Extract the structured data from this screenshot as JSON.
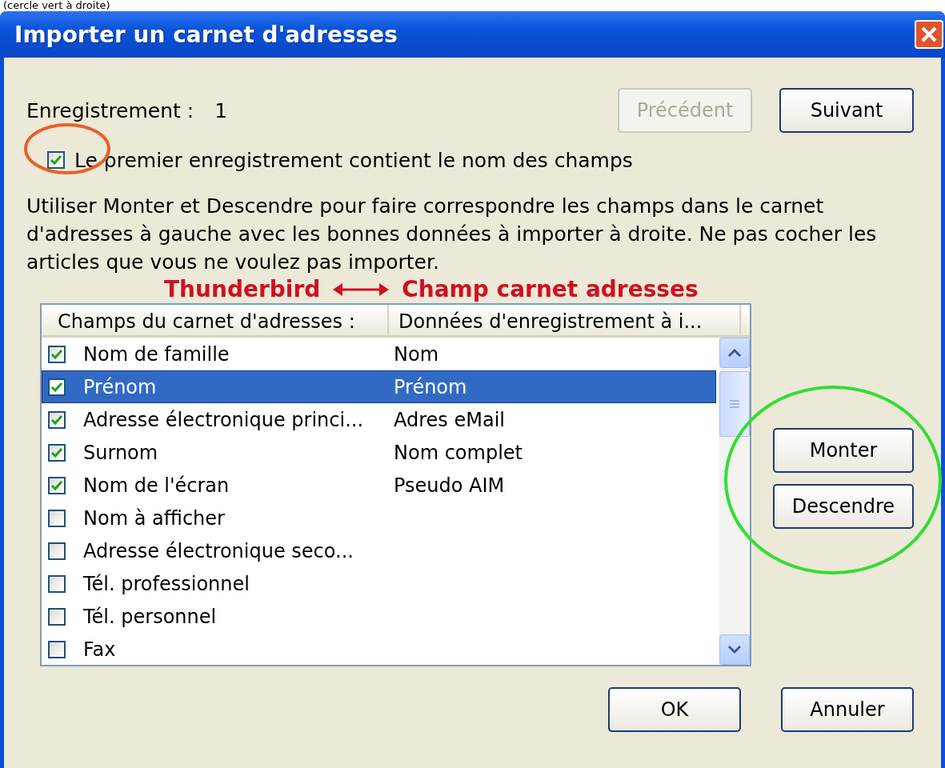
{
  "caption": "(cercle vert à droite)",
  "window": {
    "title": "Importer un carnet d'adresses"
  },
  "record": {
    "label": "Enregistrement :",
    "value": "1"
  },
  "nav_buttons": [
    {
      "label": "Précédent",
      "disabled": true
    },
    {
      "label": "Suivant",
      "disabled": false
    }
  ],
  "first_record_checkbox": {
    "label": "Le premier enregistrement contient le nom des champs",
    "checked": true
  },
  "instructions": "Utiliser Monter et Descendre pour faire correspondre les champs dans le carnet d'adresses à gauche avec les bonnes données à importer à droite. Ne pas cocher les articles que vous ne voulez pas importer.",
  "annotation": {
    "left": "Thunderbird",
    "right": "Champ carnet adresses"
  },
  "table": {
    "columns": [
      "Champs du carnet d'adresses :",
      "Données d'enregistrement à i..."
    ],
    "rows": [
      {
        "field": "Nom de famille",
        "data": "Nom",
        "checked": true,
        "selected": false
      },
      {
        "field": "Prénom",
        "data": "Prénom",
        "checked": true,
        "selected": true
      },
      {
        "field": "Adresse électronique princi...",
        "data": "Adres eMail",
        "checked": true,
        "selected": false
      },
      {
        "field": "Surnom",
        "data": "Nom complet",
        "checked": true,
        "selected": false
      },
      {
        "field": "Nom de l'écran",
        "data": "Pseudo AIM",
        "checked": true,
        "selected": false
      },
      {
        "field": "Nom à afficher",
        "checked": false,
        "selected": false
      },
      {
        "field": "Adresse électronique seco...",
        "checked": false,
        "selected": false
      },
      {
        "field": "Tél. professionnel",
        "checked": false,
        "selected": false
      },
      {
        "field": "Tél. personnel",
        "checked": false,
        "selected": false
      },
      {
        "field": "Fax",
        "checked": false,
        "selected": false
      }
    ]
  },
  "move_buttons": [
    "Monter",
    "Descendre"
  ],
  "buttons": [
    "OK",
    "Annuler"
  ]
}
